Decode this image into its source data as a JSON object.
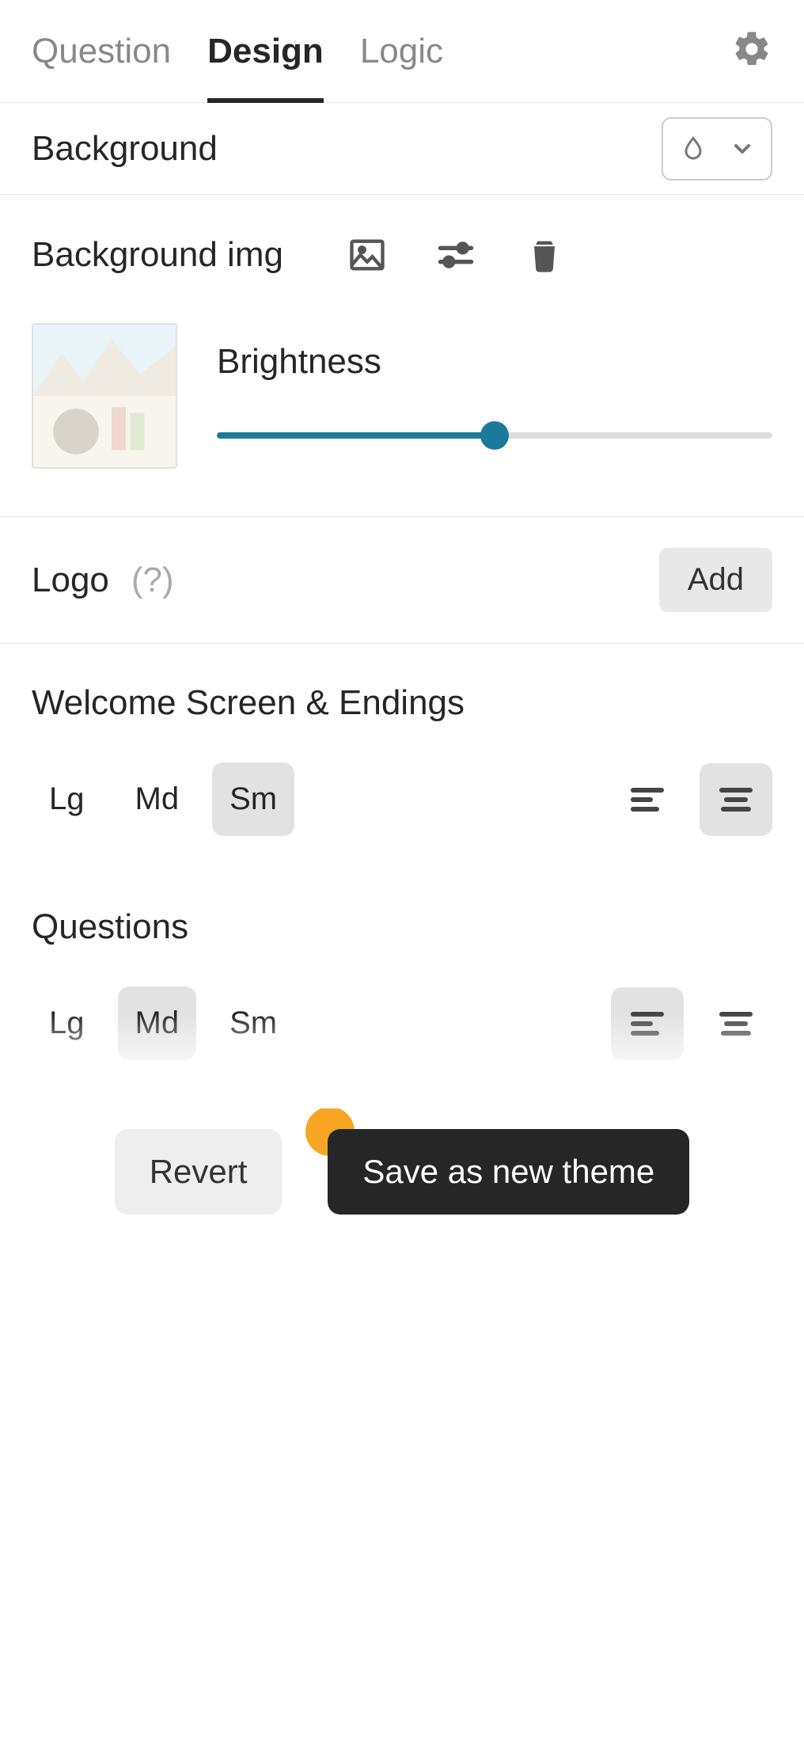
{
  "tabs": {
    "question": "Question",
    "design": "Design",
    "logic": "Logic"
  },
  "background": {
    "label": "Background"
  },
  "backgroundImg": {
    "label": "Background img",
    "brightnessLabel": "Brightness",
    "brightnessPct": 50
  },
  "logo": {
    "label": "Logo",
    "hint": "(?)",
    "addLabel": "Add"
  },
  "welcome": {
    "title": "Welcome Screen & Endings",
    "sizes": {
      "lg": "Lg",
      "md": "Md",
      "sm": "Sm"
    },
    "activeSize": "sm",
    "activeAlign": "center"
  },
  "questions": {
    "title": "Questions",
    "sizes": {
      "lg": "Lg",
      "md": "Md",
      "sm": "Sm"
    },
    "activeSize": "md",
    "activeAlign": "left"
  },
  "footer": {
    "revert": "Revert",
    "save": "Save as new theme"
  },
  "colors": {
    "accent": "#1a7a9a",
    "highlight": "#f6a623"
  }
}
